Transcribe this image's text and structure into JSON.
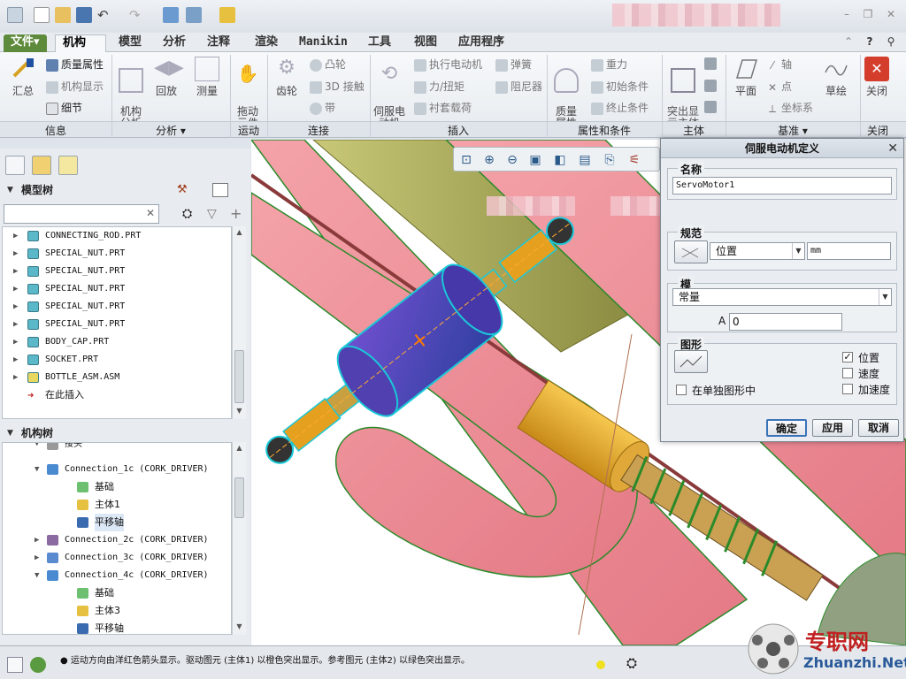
{
  "tabs": {
    "file": "文件▾",
    "items": [
      "机构",
      "模型",
      "分析",
      "注释",
      "渲染",
      "Manikin",
      "工具",
      "视图",
      "应用程序"
    ]
  },
  "ribbon": {
    "info": {
      "summary": "汇总",
      "mass": "质量属性",
      "mech_display": "机构显示",
      "detail": "细节",
      "group": "信息"
    },
    "analysis": {
      "mech_analysis": "机构\n分析",
      "playback": "回放",
      "measure": "测量",
      "group": "分析 ▾"
    },
    "motion": {
      "drag": "拖动\n元件",
      "group": "运动"
    },
    "connect": {
      "gear": "齿轮",
      "cam": "凸轮",
      "contact3d": "3D 接触",
      "belt": "带",
      "group": "连接"
    },
    "insert": {
      "servo": "伺服电\n动机",
      "actuator": "执行电动机",
      "force": "力/扭矩",
      "bushing": "衬套载荷",
      "spring": "弹簧",
      "damper": "阻尼器",
      "group": "插入"
    },
    "props": {
      "mass": "质量\n属性",
      "gravity": "重力",
      "init": "初始条件",
      "term": "终止条件",
      "group": "属性和条件"
    },
    "body": {
      "highlight": "突出显\n示主体",
      "group": "主体"
    },
    "datum": {
      "plane": "平面",
      "axis": "轴",
      "point": "点",
      "csys": "坐标系",
      "sketch": "草绘",
      "group": "基准 ▾"
    },
    "close": {
      "close": "关闭",
      "group": "关闭"
    }
  },
  "model_tree": {
    "title": "模型树",
    "items": [
      {
        "label": "CONNECTING_ROD.PRT"
      },
      {
        "label": "SPECIAL_NUT.PRT"
      },
      {
        "label": "SPECIAL_NUT.PRT"
      },
      {
        "label": "SPECIAL_NUT.PRT"
      },
      {
        "label": "SPECIAL_NUT.PRT"
      },
      {
        "label": "SPECIAL_NUT.PRT"
      },
      {
        "label": "BODY_CAP.PRT"
      },
      {
        "label": "SOCKET.PRT"
      },
      {
        "label": "BOTTLE_ASM.ASM"
      },
      {
        "label": "在此插入"
      }
    ]
  },
  "mech_tree": {
    "title": "机构树",
    "items": [
      {
        "label": "接头"
      },
      {
        "label": "Connection_1c (CORK_DRIVER)"
      },
      {
        "label": "基础"
      },
      {
        "label": "主体1"
      },
      {
        "label": "平移轴"
      },
      {
        "label": "Connection_2c (CORK_DRIVER)"
      },
      {
        "label": "Connection_3c (CORK_DRIVER)"
      },
      {
        "label": "Connection_4c (CORK_DRIVER)"
      },
      {
        "label": "基础"
      },
      {
        "label": "主体3"
      },
      {
        "label": "平移轴"
      }
    ]
  },
  "dialog": {
    "title": "伺服电动机定义",
    "name_label": "名称",
    "name_value": "ServoMotor1",
    "spec_label": "规范",
    "spec_type": "位置",
    "spec_unit": "mm",
    "profile_label": "模",
    "profile_value": "常量",
    "a_label": "A",
    "a_value": "0",
    "graph_label": "图形",
    "separate_graph": "在单独图形中",
    "cb_position": "位置",
    "cb_velocity": "速度",
    "cb_accel": "加速度",
    "ok": "确定",
    "apply": "应用",
    "cancel": "取消"
  },
  "status": {
    "message": "● 运动方向由洋红色箭头显示。驱动图元 (主体1) 以橙色突出显示。参考图元 (主体2) 以绿色突出显示。"
  },
  "watermark": {
    "cn": "专职网",
    "en": "Zhuanzhi.Net"
  }
}
